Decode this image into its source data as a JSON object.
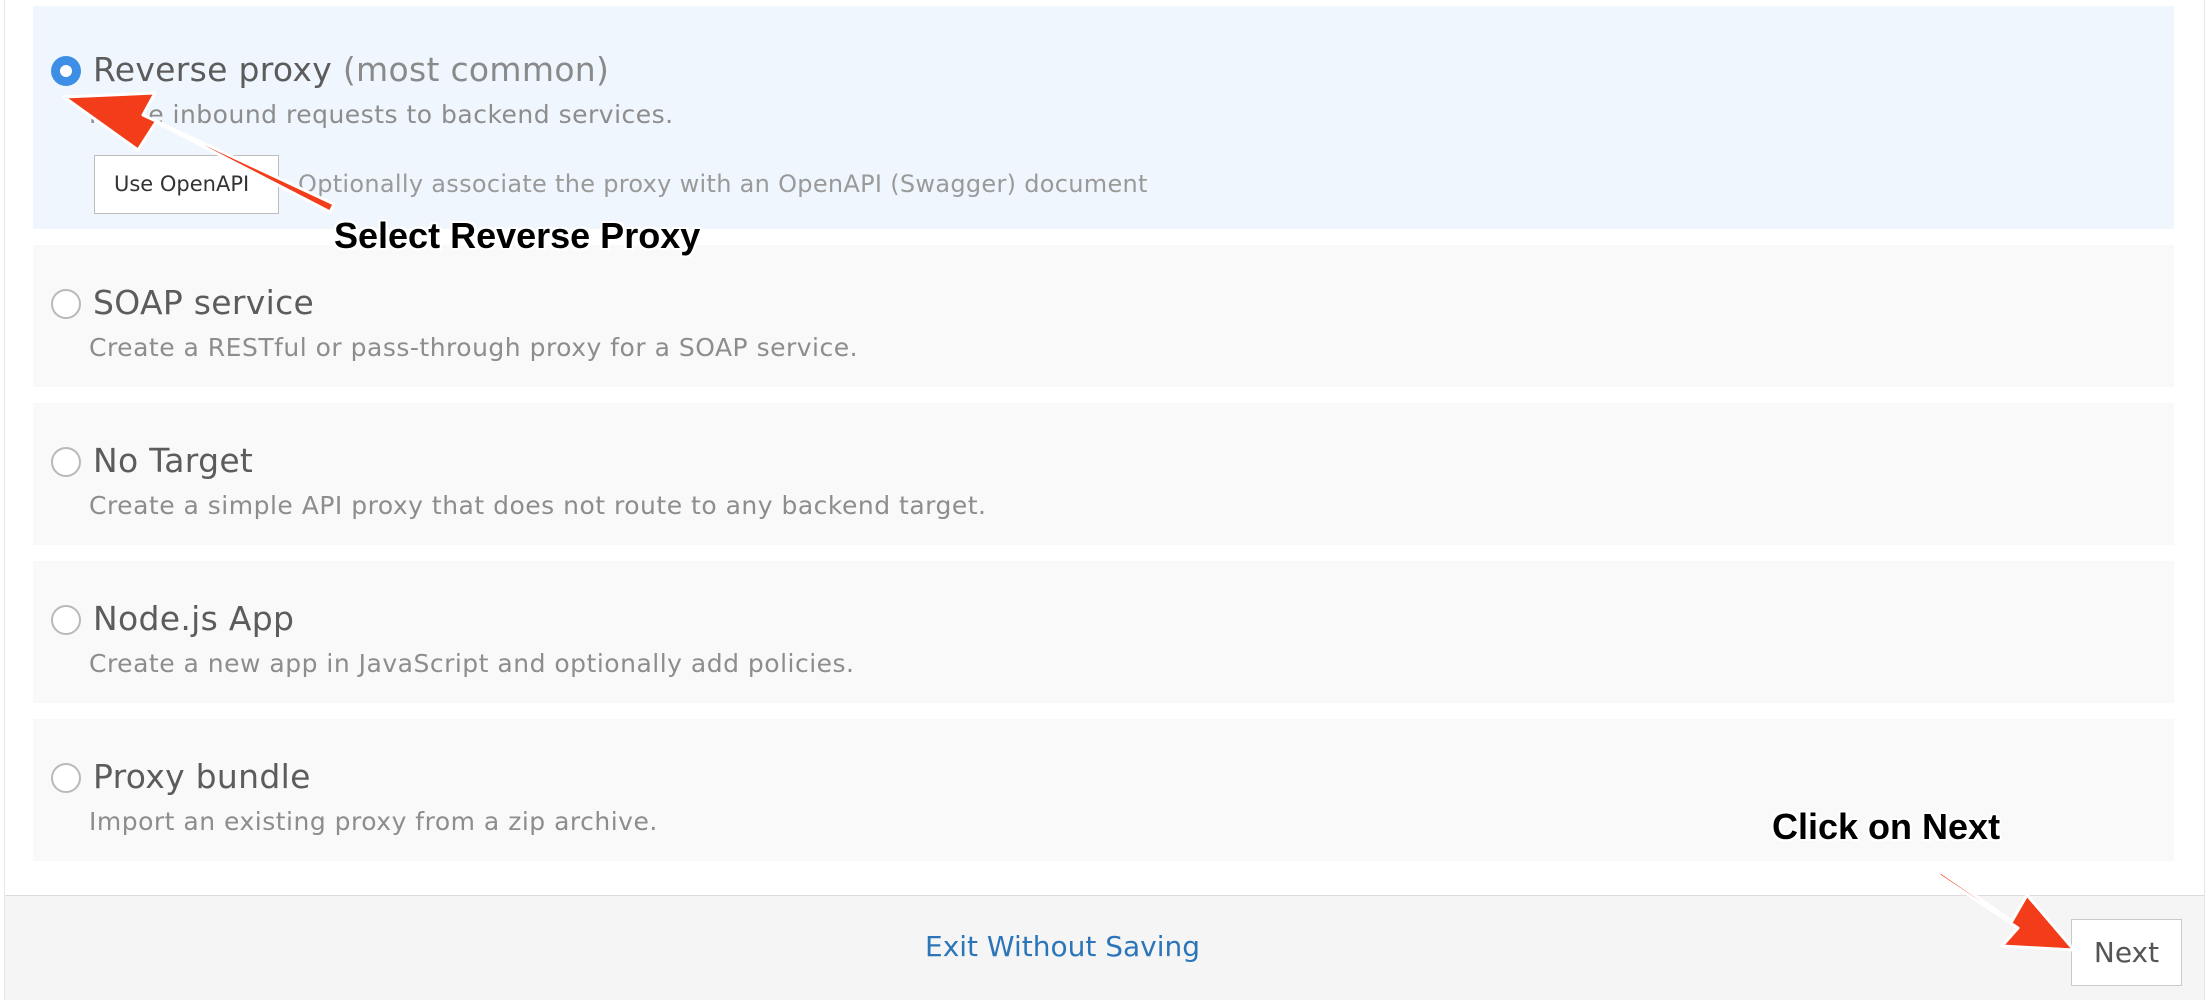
{
  "options": [
    {
      "title": "Reverse proxy",
      "title_suffix": "(most common)",
      "description": "Route inbound requests to backend services.",
      "selected": true,
      "openapi_button_label": "Use OpenAPI",
      "openapi_hint": "Optionally associate the proxy with an OpenAPI (Swagger) document"
    },
    {
      "title": "SOAP service",
      "description": "Create a RESTful or pass-through proxy for a SOAP service.",
      "selected": false
    },
    {
      "title": "No Target",
      "description": "Create a simple API proxy that does not route to any backend target.",
      "selected": false
    },
    {
      "title": "Node.js App",
      "description": "Create a new app in JavaScript and optionally add policies.",
      "selected": false
    },
    {
      "title": "Proxy bundle",
      "description": "Import an existing proxy from a zip archive.",
      "selected": false
    }
  ],
  "footer": {
    "exit_label": "Exit Without Saving",
    "next_label": "Next"
  },
  "annotations": {
    "select_reverse_proxy": "Select Reverse Proxy",
    "click_on_next": "Click on Next",
    "arrow_color": "#f23c1a"
  },
  "colors": {
    "selected_background": "#eff6fd",
    "option_background": "#f9f9f9",
    "radio_checked": "#3d8fe6",
    "link": "#2c75b8"
  }
}
